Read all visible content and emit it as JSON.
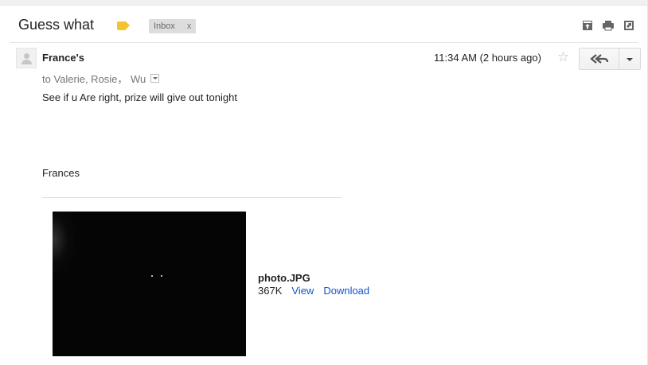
{
  "subject": "Guess what",
  "label_chip": {
    "text": "Inbox",
    "remove": "x"
  },
  "label_color": "#f4c430",
  "header_icons": [
    "archive-icon",
    "print-icon",
    "new-window-icon"
  ],
  "message": {
    "sender": "France's",
    "recipients": "to Valerie, Rosie， Wu",
    "timestamp": "11:34 AM (2 hours ago)",
    "star_glyph": "☆",
    "body": "See if u Are right, prize will give out tonight",
    "signature": "Frances"
  },
  "attachment": {
    "filename": "photo.JPG",
    "size": "367K",
    "view_label": "View",
    "download_label": "Download"
  },
  "colors": {
    "link": "#1155cc",
    "accent_label": "#f4c430"
  }
}
